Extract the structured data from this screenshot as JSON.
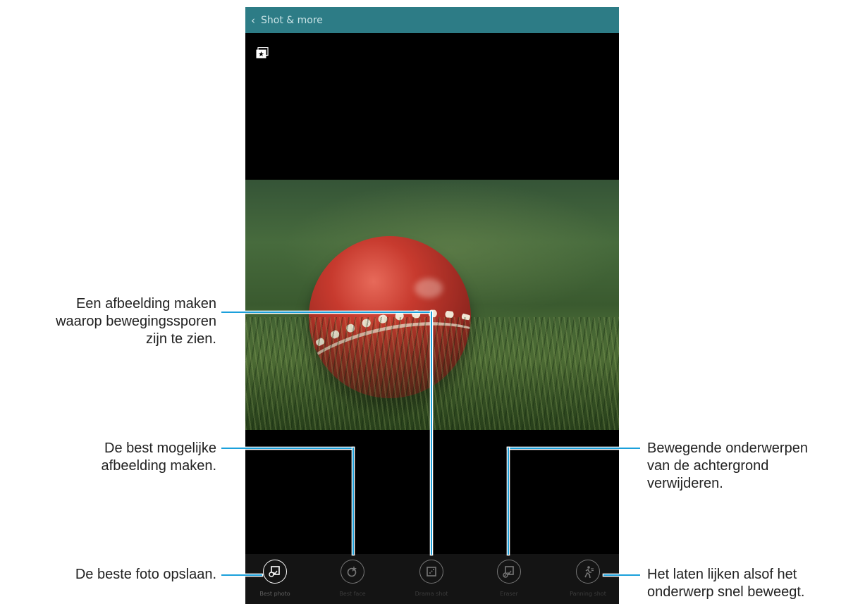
{
  "header": {
    "back_icon": "chevron-left-icon",
    "title": "Shot & more"
  },
  "modes": [
    {
      "label": "Best photo",
      "icon": "best-photo-icon",
      "active": true
    },
    {
      "label": "Best face",
      "icon": "best-face-icon",
      "active": false
    },
    {
      "label": "Drama shot",
      "icon": "drama-shot-icon",
      "active": false
    },
    {
      "label": "Eraser",
      "icon": "eraser-icon",
      "active": false
    },
    {
      "label": "Panning shot",
      "icon": "panning-shot-icon",
      "active": false
    }
  ],
  "callouts": {
    "drama": [
      "Een afbeelding maken",
      "waarop bewegingssporen",
      "zijn te zien."
    ],
    "best_face": [
      "De best mogelijke",
      "afbeelding maken."
    ],
    "best_photo": [
      "De beste foto opslaan."
    ],
    "eraser": [
      "Bewegende onderwerpen",
      "van de achtergrond",
      "verwijderen."
    ],
    "panning": [
      "Het laten lijken alsof het",
      "onderwerp snel beweegt."
    ]
  },
  "colors": {
    "accent": "#2d7c86",
    "leader_line": "#1ba0db"
  }
}
